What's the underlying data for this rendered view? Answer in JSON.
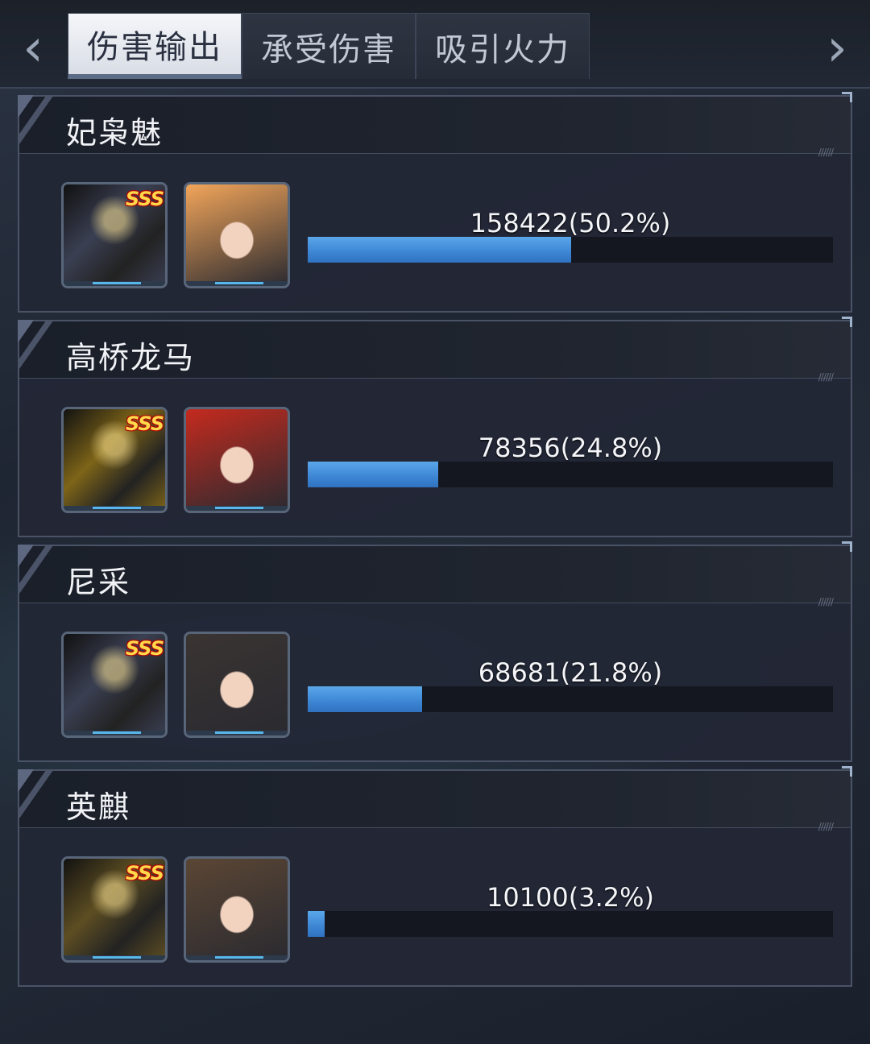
{
  "nav": {
    "prev_icon": "‹",
    "next_icon": "›"
  },
  "tabs": [
    {
      "label": "伤害输出",
      "active": true
    },
    {
      "label": "承受伤害",
      "active": false
    },
    {
      "label": "吸引火力",
      "active": false
    }
  ],
  "players": [
    {
      "name": "妃枭魅",
      "value": "158422(50.2%)",
      "percent": 50.2,
      "mech_rank": "SSS",
      "mech_color": "#3a3f52",
      "pilot_color": "#f2a55a"
    },
    {
      "name": "高桥龙马",
      "value": "78356(24.8%)",
      "percent": 24.8,
      "mech_rank": "SSS",
      "mech_color": "#7d6418",
      "pilot_color": "#c42a1e"
    },
    {
      "name": "尼采",
      "value": "68681(21.8%)",
      "percent": 21.8,
      "mech_rank": "SSS",
      "mech_color": "#3a3f52",
      "pilot_color": "#3a3432"
    },
    {
      "name": "英麒",
      "value": "10100(3.2%)",
      "percent": 3.2,
      "mech_rank": "SSS",
      "mech_color": "#5d4e22",
      "pilot_color": "#5b4634"
    }
  ]
}
